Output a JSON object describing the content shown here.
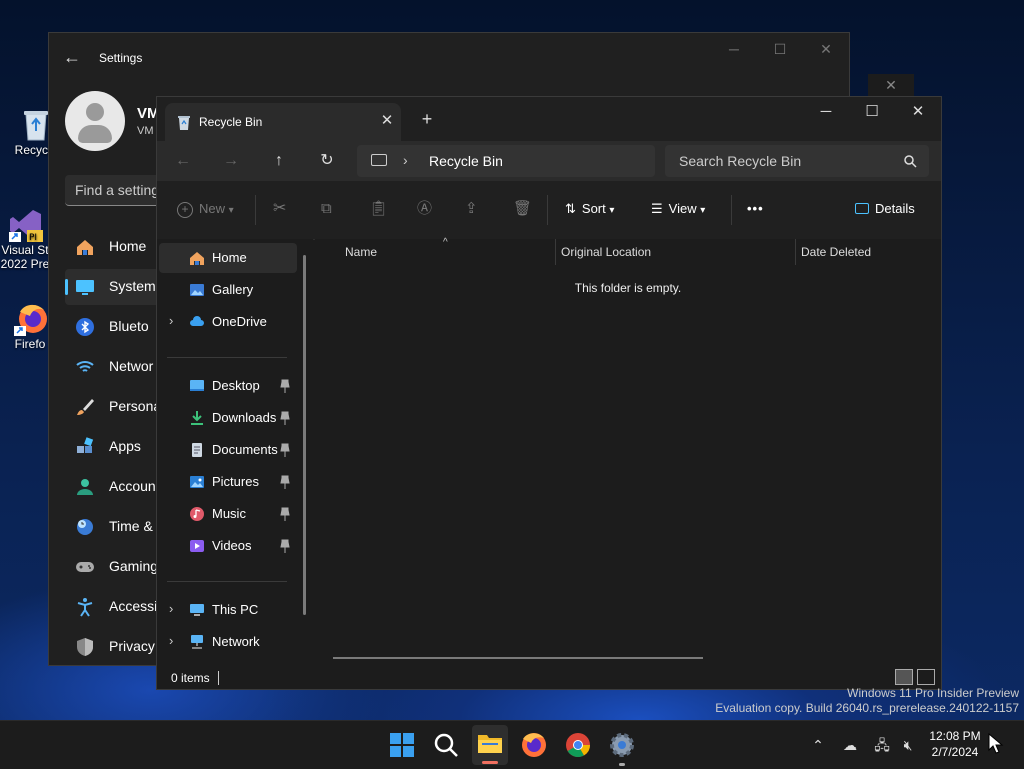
{
  "desktop": {
    "icons": [
      {
        "label": "Recycle"
      },
      {
        "label": "Visual St 2022 Pre"
      },
      {
        "label": "Firefo"
      }
    ]
  },
  "settings": {
    "title": "Settings",
    "user_name": "VM",
    "user_sub": "VM",
    "search_placeholder": "Find a setting",
    "nav": [
      {
        "label": "Home",
        "icon": "home-icon"
      },
      {
        "label": "System",
        "icon": "monitor-icon"
      },
      {
        "label": "Blueto",
        "icon": "bluetooth-icon"
      },
      {
        "label": "Networ",
        "icon": "wifi-icon"
      },
      {
        "label": "Persona",
        "icon": "brush-icon"
      },
      {
        "label": "Apps",
        "icon": "apps-icon"
      },
      {
        "label": "Accoun",
        "icon": "person-icon"
      },
      {
        "label": "Time &",
        "icon": "globe-clock-icon"
      },
      {
        "label": "Gaming",
        "icon": "gamepad-icon"
      },
      {
        "label": "Accessi",
        "icon": "accessibility-icon"
      },
      {
        "label": "Privacy",
        "icon": "shield-icon"
      }
    ],
    "selected": "System"
  },
  "explorer": {
    "tab_title": "Recycle Bin",
    "address": "Recycle Bin",
    "search_placeholder": "Search Recycle Bin",
    "toolbar": {
      "new": "New",
      "sort": "Sort",
      "view": "View",
      "more": "•••",
      "details": "Details"
    },
    "nav_groups": {
      "top": [
        {
          "label": "Home",
          "icon": "home-icon",
          "selected": true
        },
        {
          "label": "Gallery",
          "icon": "gallery-icon"
        },
        {
          "label": "OneDrive",
          "icon": "cloud-icon",
          "expandable": true
        }
      ],
      "quick": [
        {
          "label": "Desktop",
          "icon": "desktop-folder-icon"
        },
        {
          "label": "Downloads",
          "icon": "download-icon"
        },
        {
          "label": "Documents",
          "icon": "documents-icon"
        },
        {
          "label": "Pictures",
          "icon": "pictures-icon"
        },
        {
          "label": "Music",
          "icon": "music-icon"
        },
        {
          "label": "Videos",
          "icon": "videos-icon"
        }
      ],
      "devices": [
        {
          "label": "This PC",
          "icon": "pc-icon"
        },
        {
          "label": "Network",
          "icon": "network-icon"
        }
      ]
    },
    "columns": [
      "Name",
      "Original Location",
      "Date Deleted"
    ],
    "empty_text": "This folder is empty.",
    "status": "0 items"
  },
  "watermark": {
    "line1": "Windows 11 Pro Insider Preview",
    "line2": "Evaluation copy. Build 26040.rs_prerelease.240122-1157"
  },
  "taskbar": {
    "apps": [
      "start-icon",
      "search-icon",
      "file-explorer-icon",
      "firefox-icon",
      "chrome-icon",
      "settings-gear-icon"
    ],
    "tray": [
      "chevron-up-icon",
      "onedrive-off-icon",
      "network-icon",
      "volume-muted-icon"
    ],
    "time": "12:08 PM",
    "date": "2/7/2024"
  },
  "colors": {
    "accent": "#4cc2ff",
    "window_bg": "#202020",
    "explorer_bg": "#1c1c1c"
  }
}
